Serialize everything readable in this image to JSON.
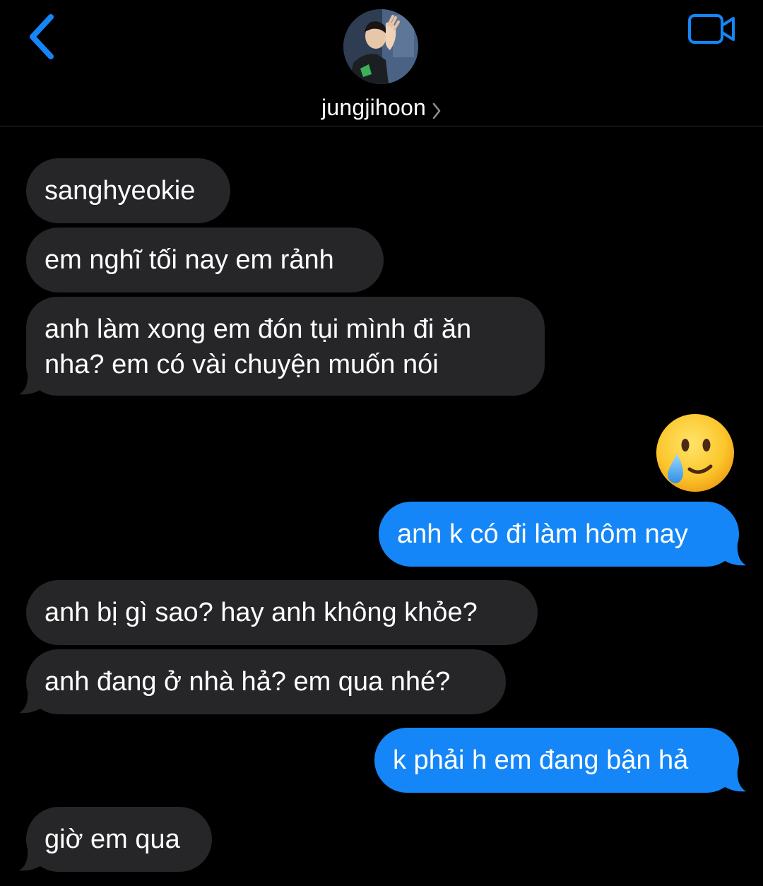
{
  "header": {
    "back_icon": "chevron-left-icon",
    "video_icon": "video-camera-icon",
    "contact_name": "jungjihoon",
    "accent_color": "#1486f7"
  },
  "messages": [
    {
      "direction": "in",
      "lines": [
        "sanghyeokie"
      ]
    },
    {
      "direction": "in",
      "lines": [
        "em nghĩ tối nay em rảnh"
      ]
    },
    {
      "direction": "in",
      "lines": [
        "anh làm xong em đón tụi mình đi ăn",
        "nha? em có vài chuyện muốn nói"
      ]
    },
    {
      "direction": "out",
      "emoji": "smiling-face-with-tear-icon"
    },
    {
      "direction": "out",
      "lines": [
        "anh k có đi làm hôm nay"
      ]
    },
    {
      "direction": "in",
      "lines": [
        "anh bị gì sao? hay anh không khỏe?"
      ]
    },
    {
      "direction": "in",
      "lines": [
        "anh đang ở nhà hả? em qua nhé?"
      ]
    },
    {
      "direction": "out",
      "lines": [
        "k phải h em đang bận hả"
      ]
    },
    {
      "direction": "in",
      "lines": [
        "giờ em qua"
      ]
    }
  ],
  "colors": {
    "incoming_bubble": "#262628",
    "outgoing_bubble": "#1486f7",
    "background": "#000000"
  }
}
